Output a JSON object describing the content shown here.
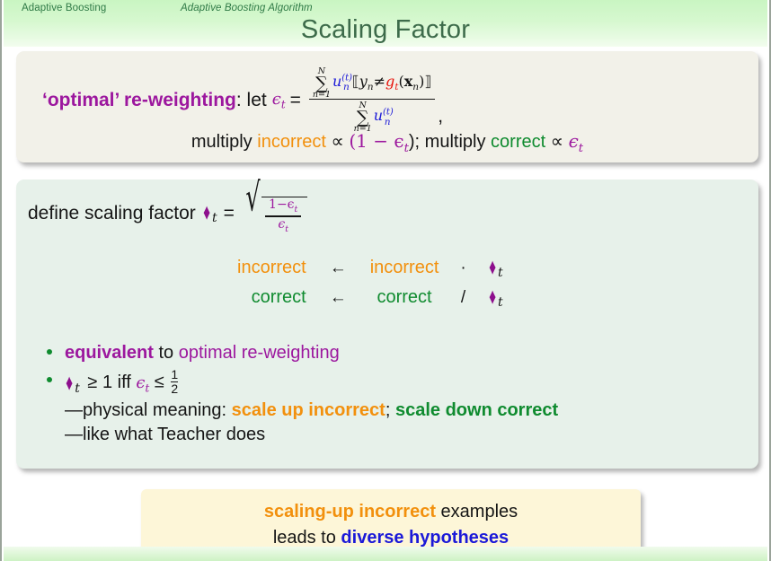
{
  "header": {
    "section": "Adaptive Boosting",
    "subsection": "Adaptive Boosting Algorithm",
    "title": "Scaling Factor",
    "colors": {
      "band": "#d6f8cf",
      "nav_text": "#2f7a46",
      "title_text": "#3d6b4a"
    }
  },
  "palette": {
    "purple": "#9c179e",
    "orange": "#f2900d",
    "green": "#0f8b2f",
    "red": "#e8120a",
    "blue": "#1b19d8",
    "black": "#151515",
    "diamond": "#8d0f8d",
    "block_cream": "#f2f1e9",
    "block_mint": "#e7f1ea",
    "block_yellow": "#fdf6d8"
  },
  "optimal_block": {
    "lead_label": "‘optimal’ re-weighting",
    "colon_let": ": let",
    "epsilon": "ϵ",
    "epsilon_sub": "t",
    "equals": "=",
    "numerator": {
      "sum_top": "N",
      "sum_bottom": "n=1",
      "sigma": "∑",
      "u": "u",
      "u_sub": "n",
      "u_sup": "(t)",
      "bracket_open": "⟦",
      "y": "y",
      "y_sub": "n",
      "neq": "≠",
      "g": "g",
      "g_sub": "t",
      "paren_open": "(",
      "x_bold": "x",
      "x_sub": "n",
      "paren_close": ")",
      "bracket_close": "⟧"
    },
    "denominator": {
      "sum_top": "N",
      "sum_bottom": "n=1",
      "sigma": "∑",
      "u": "u",
      "u_sub": "n",
      "u_sup": "(t)"
    },
    "trailing_comma": ",",
    "line2": {
      "multiply_1": "multiply",
      "incorrect": "incorrect",
      "propto_1": "∝",
      "one_minus_eps": "(1 − ϵ",
      "eps_sub": "t",
      "close_semi": "); multiply",
      "correct": "correct",
      "propto_2": "∝",
      "epsilon": "ϵ",
      "epsilon_sub": "t"
    }
  },
  "scaling_block": {
    "define_prefix": "define scaling factor",
    "diamond_glyph": "♦",
    "diamond_sub": "t",
    "equals": "=",
    "sqrt_glyph": "√",
    "sqrt_numerator": "1−ϵ",
    "sqrt_numerator_sub": "t",
    "sqrt_denominator": "ϵ",
    "sqrt_denominator_sub": "t",
    "update_rules": [
      {
        "target": "incorrect",
        "target_color": "orange",
        "arrow": "←",
        "source": "incorrect",
        "operator": "·",
        "factor": "♦",
        "factor_sub": "t"
      },
      {
        "target": "correct",
        "target_color": "green",
        "arrow": "←",
        "source": "correct",
        "operator": "/",
        "factor": "♦",
        "factor_sub": "t"
      }
    ],
    "bullets": {
      "b1_bold": "equivalent",
      "b1_mid": " to ",
      "b1_purple": "optimal re-weighting",
      "b2_diamond": "♦",
      "b2_diamond_sub": "t",
      "b2_geq": "≥ 1 iff",
      "b2_eps": "ϵ",
      "b2_eps_sub": "t",
      "b2_leq": "≤",
      "b2_frac_num": "1",
      "b2_frac_den": "2",
      "dash1_prefix": "—physical meaning:",
      "dash1_orange": "scale up incorrect",
      "dash1_semicolon": ";",
      "dash1_green": "scale down correct",
      "dash2": "—like what Teacher does"
    }
  },
  "callout": {
    "line1_orange": "scaling-up incorrect",
    "line1_rest": " examples",
    "line2_prefix": "leads to ",
    "line2_blue": "diverse hypotheses"
  }
}
